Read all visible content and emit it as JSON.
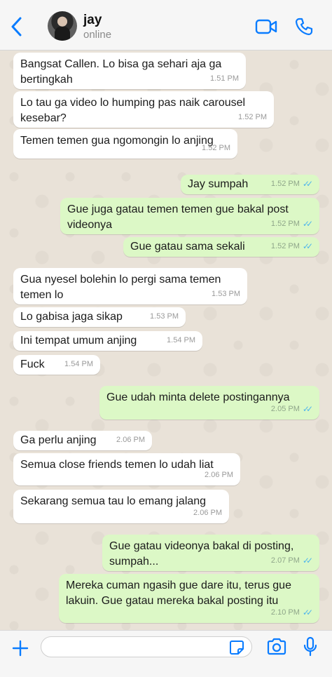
{
  "header": {
    "contact_name": "jay",
    "status": "online"
  },
  "messages": [
    {
      "dir": "in",
      "text": "Bangsat Callen. Lo bisa ga sehari aja ga bertingkah",
      "time": "1.51 PM"
    },
    {
      "dir": "in",
      "text": "Lo tau ga video lo humping pas naik carousel kesebar?",
      "time": "1.52 PM"
    },
    {
      "dir": "in",
      "text": "Temen temen gua ngomongin lo anjing",
      "time": "1.52 PM"
    },
    {
      "dir": "out",
      "text": "Jay sumpah",
      "time": "1.52 PM",
      "read": true
    },
    {
      "dir": "out",
      "text": "Gue juga gatau temen temen gue bakal post videonya",
      "time": "1.52 PM",
      "read": true
    },
    {
      "dir": "out",
      "text": "Gue gatau sama sekali",
      "time": "1.52 PM",
      "read": true
    },
    {
      "dir": "in",
      "text": "Gua nyesel bolehin lo pergi sama temen temen lo",
      "time": "1.53 PM"
    },
    {
      "dir": "in",
      "text": "Lo gabisa jaga sikap",
      "time": "1.53 PM"
    },
    {
      "dir": "in",
      "text": "Ini tempat umum anjing",
      "time": "1.54 PM"
    },
    {
      "dir": "in",
      "text": "Fuck",
      "time": "1.54 PM"
    },
    {
      "dir": "out",
      "text": "Gue udah minta delete postingannya",
      "time": "2.05 PM",
      "read": true
    },
    {
      "dir": "in",
      "text": "Ga perlu anjing",
      "time": "2.06 PM"
    },
    {
      "dir": "in",
      "text": "Semua close friends temen lo udah liat",
      "time": "2.06 PM"
    },
    {
      "dir": "in",
      "text": "Sekarang semua tau lo emang jalang",
      "time": "2.06 PM"
    },
    {
      "dir": "out",
      "text": "Gue gatau videonya bakal di posting, sumpah...",
      "time": "2.07 PM",
      "read": true
    },
    {
      "dir": "out",
      "text": "Mereka cuman ngasih gue dare itu, terus gue lakuin. Gue gatau mereka bakal posting itu",
      "time": "2.10 PM",
      "read": true
    }
  ],
  "composer": {
    "value": "",
    "placeholder": ""
  },
  "colors": {
    "accent": "#0a7cff",
    "outgoing_bubble": "#dcf8c6",
    "incoming_bubble": "#ffffff",
    "read_ticks": "#4fb6ec"
  },
  "icons": {
    "back": "chevron-left-icon",
    "video": "video-camera-icon",
    "phone": "phone-icon",
    "plus": "plus-icon",
    "sticker": "sticker-icon",
    "camera": "camera-icon",
    "mic": "microphone-icon"
  }
}
